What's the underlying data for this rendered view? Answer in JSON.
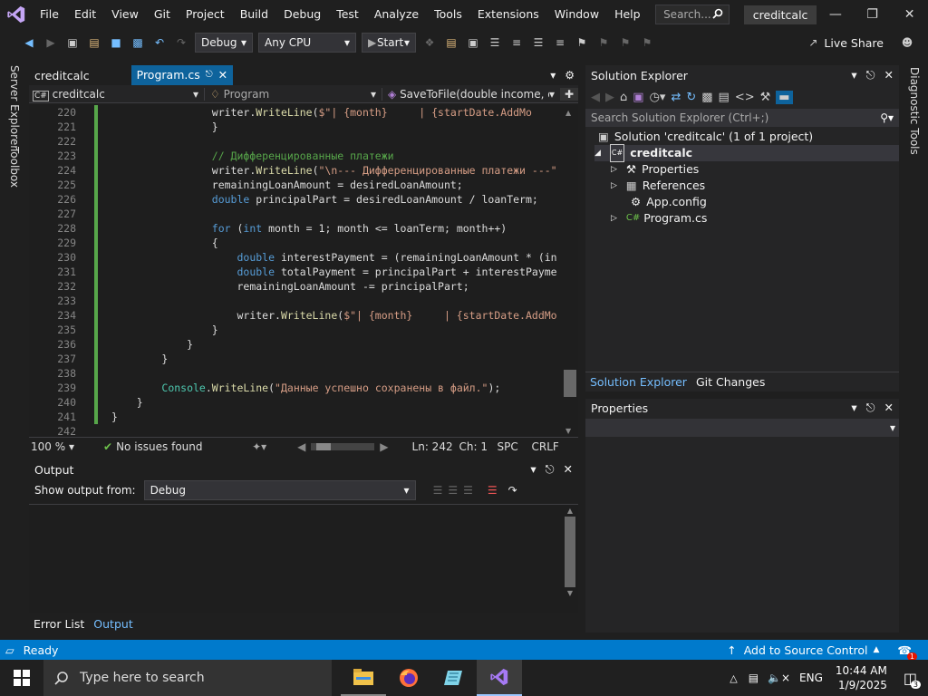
{
  "menu": [
    "File",
    "Edit",
    "View",
    "Git",
    "Project",
    "Build",
    "Debug",
    "Test",
    "Analyze",
    "Tools",
    "Extensions",
    "Window",
    "Help"
  ],
  "search": {
    "placeholder": "Search..."
  },
  "solution_name": "creditcalc",
  "toolbar": {
    "config": "Debug",
    "platform": "Any CPU",
    "start": "Start",
    "live_share": "Live Share"
  },
  "left_tools": {
    "server_explorer": "Server Explorer",
    "toolbox": "Toolbox"
  },
  "right_tools": {
    "diagnostic": "Diagnostic Tools"
  },
  "tabs": [
    {
      "label": "creditcalc"
    },
    {
      "label": "Program.cs"
    }
  ],
  "nav": {
    "project": "creditcalc",
    "class": "Program",
    "member": "SaveToFile(double income, do"
  },
  "code_lines": [
    {
      "n": "220",
      "t": "                writer.WriteLine($\"| {month}     | {startDate.AddMo"
    },
    {
      "n": "221",
      "t": "                }"
    },
    {
      "n": "222",
      "t": ""
    },
    {
      "n": "223",
      "t": "                // Дифференцированные платежи"
    },
    {
      "n": "224",
      "t": "                writer.WriteLine(\"\\n--- Дифференцированные платежи ---\""
    },
    {
      "n": "225",
      "t": "                remainingLoanAmount = desiredLoanAmount;"
    },
    {
      "n": "226",
      "t": "                double principalPart = desiredLoanAmount / loanTerm;"
    },
    {
      "n": "227",
      "t": ""
    },
    {
      "n": "228",
      "t": "                for (int month = 1; month <= loanTerm; month++)"
    },
    {
      "n": "229",
      "t": "                {"
    },
    {
      "n": "230",
      "t": "                    double interestPayment = (remainingLoanAmount * (in"
    },
    {
      "n": "231",
      "t": "                    double totalPayment = principalPart + interestPayme"
    },
    {
      "n": "232",
      "t": "                    remainingLoanAmount -= principalPart;"
    },
    {
      "n": "233",
      "t": ""
    },
    {
      "n": "234",
      "t": "                    writer.WriteLine($\"| {month}     | {startDate.AddMo"
    },
    {
      "n": "235",
      "t": "                }"
    },
    {
      "n": "236",
      "t": "            }"
    },
    {
      "n": "237",
      "t": "        }"
    },
    {
      "n": "238",
      "t": ""
    },
    {
      "n": "239",
      "t": "        Console.WriteLine(\"Данные успешно сохранены в файл.\");"
    },
    {
      "n": "240",
      "t": "    }"
    },
    {
      "n": "241",
      "t": "}"
    },
    {
      "n": "242",
      "t": ""
    }
  ],
  "editor_status": {
    "zoom": "100 %",
    "issues": "No issues found",
    "ln": "Ln: 242",
    "ch": "Ch: 1",
    "spc": "SPC",
    "crlf": "CRLF"
  },
  "output": {
    "title": "Output",
    "show_from": "Show output from:",
    "source": "Debug"
  },
  "bottom_tabs": [
    "Error List",
    "Output"
  ],
  "solution_explorer": {
    "title": "Solution Explorer",
    "search": "Search Solution Explorer (Ctrl+;)",
    "solution": "Solution 'creditcalc' (1 of 1 project)",
    "project": "creditcalc",
    "items": [
      "Properties",
      "References",
      "App.config",
      "Program.cs"
    ],
    "tabs": [
      "Solution Explorer",
      "Git Changes"
    ]
  },
  "properties": {
    "title": "Properties"
  },
  "statusbar": {
    "ready": "Ready",
    "source_control": "Add to Source Control",
    "notif_count": "1"
  },
  "taskbar": {
    "search": "Type here to search",
    "time": "10:44 AM",
    "date": "1/9/2025",
    "lang": "ENG",
    "notif": "3"
  }
}
